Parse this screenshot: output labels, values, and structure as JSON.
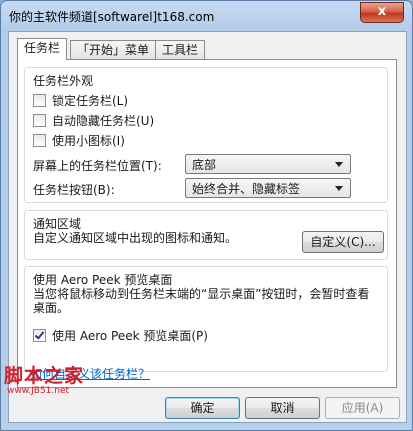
{
  "window": {
    "title": "你的主软件频道[softwarel]t168.com",
    "close_label": "x"
  },
  "tabs": [
    {
      "label": "任务栏",
      "active": true
    },
    {
      "label": "「开始」菜单",
      "active": false
    },
    {
      "label": "工具栏",
      "active": false
    }
  ],
  "appearance": {
    "title": "任务栏外观",
    "checkboxes": [
      {
        "label": "锁定任务栏(L)",
        "checked": false
      },
      {
        "label": "自动隐藏任务栏(U)",
        "checked": false
      },
      {
        "label": "使用小图标(I)",
        "checked": false
      }
    ],
    "position_label": "屏幕上的任务栏位置(T):",
    "position_value": "底部",
    "buttons_label": "任务栏按钮(B):",
    "buttons_value": "始终合并、隐藏标签"
  },
  "notification": {
    "title": "通知区域",
    "desc": "自定义通知区域中出现的图标和通知。",
    "customize_label": "自定义(C)..."
  },
  "aero": {
    "title": "使用 Aero Peek 预览桌面",
    "desc": "当您将鼠标移动到任务栏末端的“显示桌面”按钮时，会暂时查看桌面。",
    "checkbox_label": "使用 Aero Peek 预览桌面(P)",
    "checked": true
  },
  "help_link": "如何自定义该任务栏？",
  "footer": {
    "ok_label": "确定",
    "cancel_label": "取消",
    "apply_label": "应用(A)"
  },
  "watermark": {
    "logo_text": "脚本之家",
    "url_text": "www.JB51.net"
  }
}
